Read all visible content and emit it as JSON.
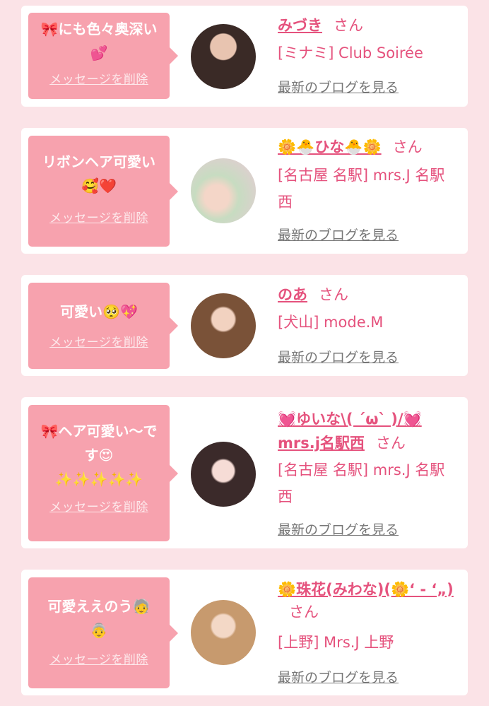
{
  "entries": [
    {
      "message": "🎀にも色々奥深い\n💕",
      "delete_label": "メッセージを削除",
      "name": "みづき",
      "honorific": "さん",
      "shop": "[ミナミ] Club Soirée",
      "blog_link": "最新のブログを見る"
    },
    {
      "message": "リボンヘア可愛い\n🥰❤️",
      "delete_label": "メッセージを削除",
      "name": "🌼🐣ひな🐣🌼",
      "honorific": "さん",
      "shop": "[名古屋 名駅] mrs.J 名駅西",
      "blog_link": "最新のブログを見る"
    },
    {
      "message": "可愛い🥺💖",
      "delete_label": "メッセージを削除",
      "name": "のあ",
      "honorific": "さん",
      "shop": "[犬山] mode.M",
      "blog_link": "最新のブログを見る"
    },
    {
      "message": "🎀ヘア可愛い〜で\nす😍\n✨✨✨✨✨",
      "delete_label": "メッセージを削除",
      "name": "💓ゆいな\\( ´ω` )/💓mrs.j名駅西",
      "honorific": "さん",
      "shop": "[名古屋 名駅] mrs.J 名駅西",
      "blog_link": "最新のブログを見る"
    },
    {
      "message": "可愛ええのう🧓\n👵",
      "delete_label": "メッセージを削除",
      "name": "🌼珠花(みわな)(🌼‘ - ‘„)",
      "honorific": "さん",
      "shop": "[上野] Mrs.J 上野",
      "blog_link": "最新のブログを見る"
    }
  ],
  "colors": {
    "background": "#fbe3e7",
    "bubble": "#f7a2ae",
    "accent": "#e5527d",
    "link_gray": "#777777"
  }
}
